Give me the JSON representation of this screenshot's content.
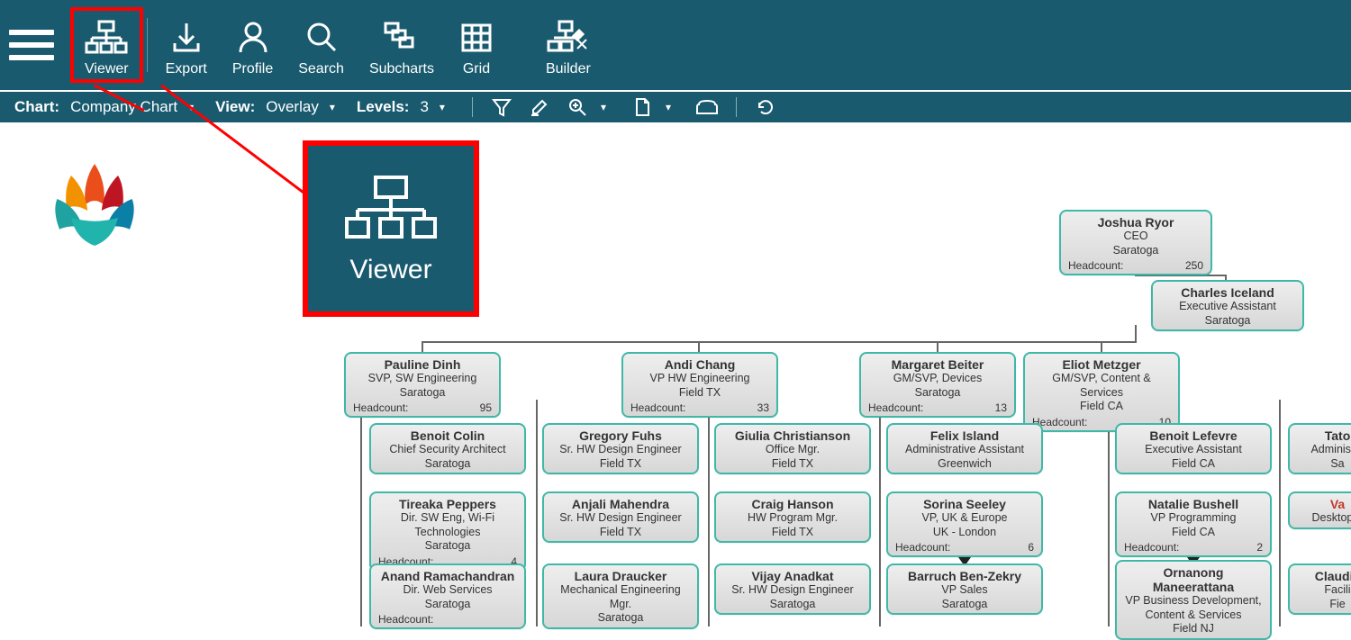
{
  "topbar": {
    "items": [
      {
        "label": "Viewer"
      },
      {
        "label": "Export"
      },
      {
        "label": "Profile"
      },
      {
        "label": "Search"
      },
      {
        "label": "Subcharts"
      },
      {
        "label": "Grid"
      },
      {
        "label": "Builder"
      }
    ]
  },
  "subbar": {
    "chart_label": "Chart:",
    "chart_value": "Company Chart",
    "view_label": "View:",
    "view_value": "Overlay",
    "levels_label": "Levels:",
    "levels_value": "3"
  },
  "callout": {
    "label": "Viewer"
  },
  "headcount_label": "Headcount:",
  "nodes": {
    "ceo": {
      "name": "Joshua Ryor",
      "title": "CEO",
      "loc": "Saratoga",
      "hc": "250"
    },
    "charles": {
      "name": "Charles Iceland",
      "title": "Executive Assistant",
      "loc": "Saratoga"
    },
    "pauline": {
      "name": "Pauline Dinh",
      "title": "SVP, SW Engineering",
      "loc": "Saratoga",
      "hc": "95"
    },
    "andi": {
      "name": "Andi Chang",
      "title": "VP HW Engineering",
      "loc": "Field TX",
      "hc": "33"
    },
    "margaret": {
      "name": "Margaret Beiter",
      "title": "GM/SVP, Devices",
      "loc": "Saratoga",
      "hc": "13"
    },
    "eliot": {
      "name": "Eliot Metzger",
      "title": "GM/SVP, Content & Services",
      "loc": "Field CA",
      "hc": "10"
    },
    "benoitc": {
      "name": "Benoit Colin",
      "title": "Chief Security Architect",
      "loc": "Saratoga"
    },
    "gregory": {
      "name": "Gregory Fuhs",
      "title": "Sr. HW Design Engineer",
      "loc": "Field TX"
    },
    "giulia": {
      "name": "Giulia Christianson",
      "title": "Office Mgr.",
      "loc": "Field TX"
    },
    "felix": {
      "name": "Felix Island",
      "title": "Administrative Assistant",
      "loc": "Greenwich"
    },
    "benoitl": {
      "name": "Benoit Lefevre",
      "title": "Executive Assistant",
      "loc": "Field CA"
    },
    "tato": {
      "name": "Tato",
      "title": "Administra",
      "loc": "Sa"
    },
    "tireaka": {
      "name": "Tireaka Peppers",
      "title": "Dir. SW Eng, Wi-Fi Technologies",
      "loc": "Saratoga",
      "hc": "4"
    },
    "anjali": {
      "name": "Anjali Mahendra",
      "title": "Sr. HW Design Engineer",
      "loc": "Field TX"
    },
    "craig": {
      "name": "Craig Hanson",
      "title": "HW Program Mgr.",
      "loc": "Field TX"
    },
    "sorina": {
      "name": "Sorina Seeley",
      "title": "VP, UK & Europe",
      "loc": "UK - London",
      "hc": "6"
    },
    "natalie": {
      "name": "Natalie Bushell",
      "title": "VP Programming",
      "loc": "Field CA",
      "hc": "2"
    },
    "va": {
      "name": "Va",
      "title": "Desktop A",
      "loc": ""
    },
    "anand": {
      "name": "Anand Ramachandran",
      "title": "Dir. Web Services",
      "loc": "Saratoga",
      "hc": ""
    },
    "laura": {
      "name": "Laura Draucker",
      "title": "Mechanical Engineering Mgr.",
      "loc": "Saratoga"
    },
    "vijay": {
      "name": "Vijay Anadkat",
      "title": "Sr. HW Design Engineer",
      "loc": "Saratoga"
    },
    "barruch": {
      "name": "Barruch Ben-Zekry",
      "title": "VP Sales",
      "loc": "Saratoga"
    },
    "ornanong": {
      "name": "Ornanong Maneerattana",
      "title": "VP Business Development, Content & Services",
      "loc": "Field NJ"
    },
    "claudia": {
      "name": "Claudia",
      "title": "Facili",
      "loc": "Fie"
    }
  }
}
